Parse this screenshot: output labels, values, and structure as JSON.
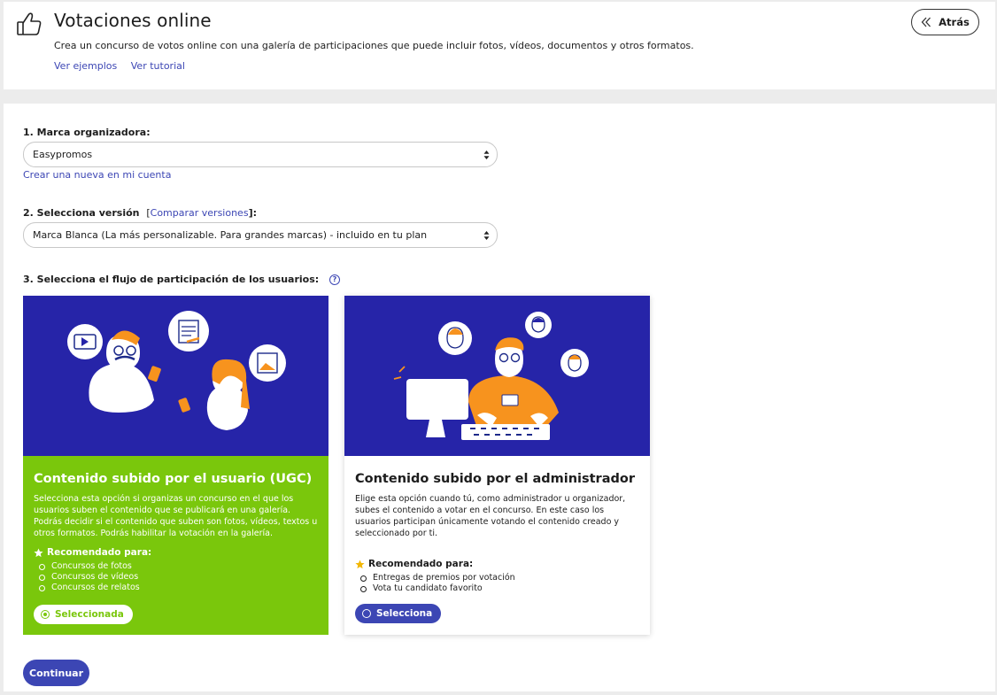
{
  "header": {
    "title": "Votaciones online",
    "description": "Crea un concurso de votos online con una galería de participaciones que puede incluir fotos, vídeos, documentos y otros formatos.",
    "link_examples": "Ver ejemplos",
    "link_tutorial": "Ver tutorial",
    "back_label": "Atrás"
  },
  "step1": {
    "label": "1. Marca organizadora:",
    "selected": "Easypromos",
    "create_link": "Crear una nueva en mi cuenta"
  },
  "step2": {
    "label": "2. Selecciona versión",
    "bracket_open": "[",
    "compare_link": "Comparar versiones",
    "bracket_close": "]:",
    "selected": "Marca Blanca (La más personalizable. Para grandes marcas) - incluido en tu plan"
  },
  "step3": {
    "label": "3. Selecciona el flujo de participación de los usuarios:",
    "help_icon": "?"
  },
  "cards": [
    {
      "title": "Contenido subido por el usuario (UGC)",
      "text": "Selecciona esta opción si organizas un concurso en el que los usuarios suben el contenido que se publicará en una galería. Podrás decidir si el contenido que suben son fotos, vídeos, textos u otros formatos. Podrás habilitar la votación en la galería.",
      "recommended_label": "Recomendado para:",
      "items": [
        "Concursos de fotos",
        "Concursos de vídeos",
        "Concursos de relatos"
      ],
      "button_label": "Seleccionada",
      "selected": true
    },
    {
      "title": "Contenido subido por el administrador",
      "text": "Elige esta opción cuando tú, como administrador u organizador, subes el contenido a votar en el concurso. En este caso los usuarios participan únicamente votando el contenido creado y seleccionado por ti.",
      "recommended_label": "Recomendado para:",
      "items": [
        "Entregas de premios por votación",
        "Vota tu candidato favorito"
      ],
      "button_label": "Selecciona",
      "selected": false
    }
  ],
  "continue_label": "Continuar",
  "colors": {
    "accent": "#3c46b4",
    "green": "#7ac70c",
    "illustration_bg": "#2624a8",
    "orange": "#f7931e"
  }
}
